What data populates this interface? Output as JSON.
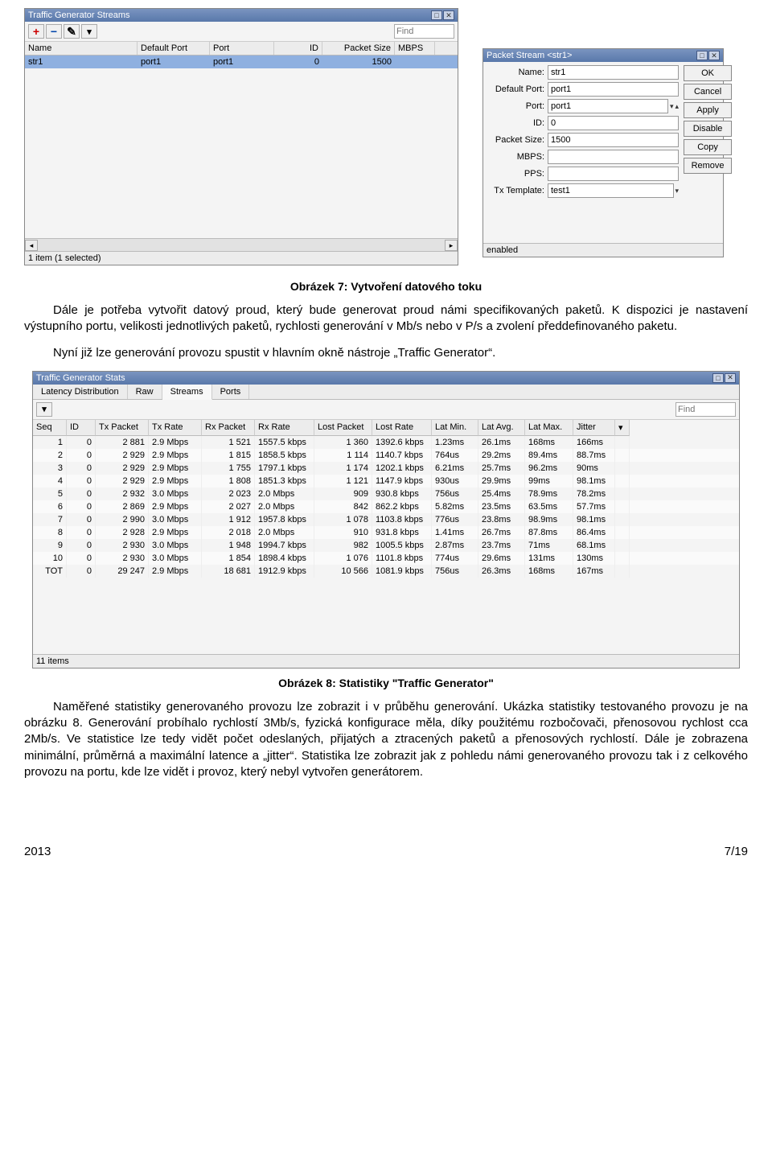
{
  "win1": {
    "title": "Traffic Generator Streams",
    "findPlaceholder": "Find",
    "columns": [
      "Name",
      "Default Port",
      "Port",
      "ID",
      "Packet Size",
      "MBPS"
    ],
    "row": {
      "name": "str1",
      "defaultPort": "port1",
      "port": "port1",
      "id": "0",
      "packetSize": "1500",
      "mbps": ""
    },
    "status": "1 item (1 selected)"
  },
  "win2": {
    "title": "Packet Stream <str1>",
    "fields": {
      "name": {
        "label": "Name:",
        "value": "str1"
      },
      "defaultPort": {
        "label": "Default Port:",
        "value": "port1"
      },
      "port": {
        "label": "Port:",
        "value": "port1"
      },
      "id": {
        "label": "ID:",
        "value": "0"
      },
      "packetSize": {
        "label": "Packet Size:",
        "value": "1500"
      },
      "mbps": {
        "label": "MBPS:",
        "value": ""
      },
      "pps": {
        "label": "PPS:",
        "value": ""
      },
      "txTemplate": {
        "label": "Tx Template:",
        "value": "test1"
      }
    },
    "buttons": {
      "ok": "OK",
      "cancel": "Cancel",
      "apply": "Apply",
      "disable": "Disable",
      "copy": "Copy",
      "remove": "Remove"
    },
    "enabled": "enabled"
  },
  "caption1": "Obrázek 7: Vytvoření datového toku",
  "para1": "Dále je potřeba vytvořit datový proud, který bude generovat proud námi specifikovaných paketů. K dispozici je nastavení výstupního portu, velikosti jednotlivých paketů, rychlosti generování v Mb/s nebo v P/s a zvolení předdefinovaného paketu.",
  "para2": "Nyní již lze generování provozu spustit v hlavním okně nástroje „Traffic Generator“.",
  "win3": {
    "title": "Traffic Generator Stats",
    "tabs": [
      "Latency Distribution",
      "Raw",
      "Streams",
      "Ports"
    ],
    "findPlaceholder": "Find",
    "columns": [
      "Seq",
      "ID",
      "Tx Packet",
      "Tx Rate",
      "Rx Packet",
      "Rx Rate",
      "Lost Packet",
      "Lost Rate",
      "Lat Min.",
      "Lat Avg.",
      "Lat Max.",
      "Jitter"
    ],
    "rows": [
      [
        "1",
        "0",
        "2 881",
        "2.9 Mbps",
        "1 521",
        "1557.5 kbps",
        "1 360",
        "1392.6 kbps",
        "1.23ms",
        "26.1ms",
        "168ms",
        "166ms"
      ],
      [
        "2",
        "0",
        "2 929",
        "2.9 Mbps",
        "1 815",
        "1858.5 kbps",
        "1 114",
        "1140.7 kbps",
        "764us",
        "29.2ms",
        "89.4ms",
        "88.7ms"
      ],
      [
        "3",
        "0",
        "2 929",
        "2.9 Mbps",
        "1 755",
        "1797.1 kbps",
        "1 174",
        "1202.1 kbps",
        "6.21ms",
        "25.7ms",
        "96.2ms",
        "90ms"
      ],
      [
        "4",
        "0",
        "2 929",
        "2.9 Mbps",
        "1 808",
        "1851.3 kbps",
        "1 121",
        "1147.9 kbps",
        "930us",
        "29.9ms",
        "99ms",
        "98.1ms"
      ],
      [
        "5",
        "0",
        "2 932",
        "3.0 Mbps",
        "2 023",
        "2.0 Mbps",
        "909",
        "930.8 kbps",
        "756us",
        "25.4ms",
        "78.9ms",
        "78.2ms"
      ],
      [
        "6",
        "0",
        "2 869",
        "2.9 Mbps",
        "2 027",
        "2.0 Mbps",
        "842",
        "862.2 kbps",
        "5.82ms",
        "23.5ms",
        "63.5ms",
        "57.7ms"
      ],
      [
        "7",
        "0",
        "2 990",
        "3.0 Mbps",
        "1 912",
        "1957.8 kbps",
        "1 078",
        "1103.8 kbps",
        "776us",
        "23.8ms",
        "98.9ms",
        "98.1ms"
      ],
      [
        "8",
        "0",
        "2 928",
        "2.9 Mbps",
        "2 018",
        "2.0 Mbps",
        "910",
        "931.8 kbps",
        "1.41ms",
        "26.7ms",
        "87.8ms",
        "86.4ms"
      ],
      [
        "9",
        "0",
        "2 930",
        "3.0 Mbps",
        "1 948",
        "1994.7 kbps",
        "982",
        "1005.5 kbps",
        "2.87ms",
        "23.7ms",
        "71ms",
        "68.1ms"
      ],
      [
        "10",
        "0",
        "2 930",
        "3.0 Mbps",
        "1 854",
        "1898.4 kbps",
        "1 076",
        "1101.8 kbps",
        "774us",
        "29.6ms",
        "131ms",
        "130ms"
      ],
      [
        "TOT",
        "0",
        "29 247",
        "2.9 Mbps",
        "18 681",
        "1912.9 kbps",
        "10 566",
        "1081.9 kbps",
        "756us",
        "26.3ms",
        "168ms",
        "167ms"
      ]
    ],
    "status": "11 items"
  },
  "caption2": "Obrázek 8: Statistiky \"Traffic Generator\"",
  "para3": "Naměřené statistiky generovaného provozu lze zobrazit i v průběhu generování. Ukázka statistiky testovaného provozu je na obrázku 8. Generování probíhalo rychlostí 3Mb/s, fyzická konfigurace měla, díky použitému rozbočovači, přenosovou rychlost cca 2Mb/s. Ve statistice lze tedy vidět počet odeslaných, přijatých a ztracených paketů a přenosových rychlostí. Dále je zobrazena minimální, průměrná a maximální latence a „jitter“. Statistika lze zobrazit jak z pohledu námi generovaného provozu tak i z celkového provozu na portu, kde lze vidět i provoz, který nebyl vytvořen generátorem.",
  "footer": {
    "year": "2013",
    "page": "7/19"
  }
}
